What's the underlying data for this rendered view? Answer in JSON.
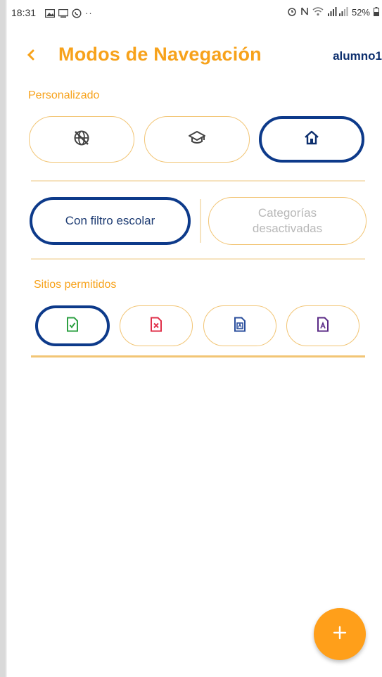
{
  "status_bar": {
    "time": "18:31",
    "battery": "52%"
  },
  "header": {
    "title": "Modos de Navegación",
    "user": "alumno1"
  },
  "sections": {
    "personalizado_label": "Personalizado",
    "sitios_label": "Sitios permitidos"
  },
  "filter": {
    "selected_label": "Con filtro escolar",
    "disabled_line1": "Categorías",
    "disabled_line2": "desactivadas"
  },
  "fab": {
    "label": "+"
  },
  "colors": {
    "accent": "#f7a21b",
    "navy": "#0d3a8a",
    "green_doc": "#2ea043",
    "red_doc": "#e0304a",
    "blue_doc": "#2a4e9c",
    "purple_doc": "#5a2a86"
  }
}
